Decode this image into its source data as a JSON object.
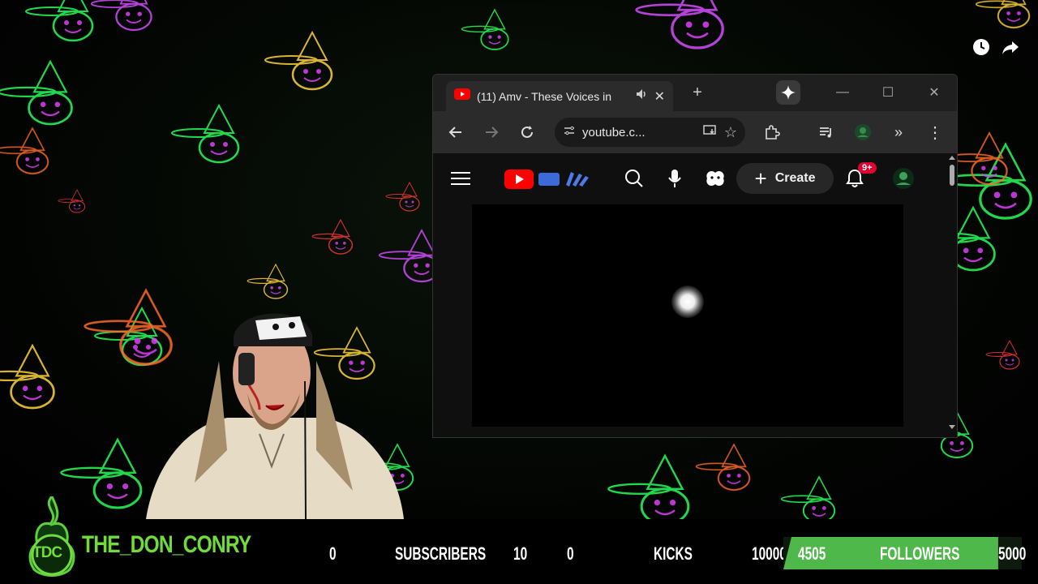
{
  "browser": {
    "tab_title": "(11) Amv - These Voices in",
    "address": "youtube.c...",
    "colors": {
      "frame": "#1f1f1f",
      "toolbar": "#2b2b2b",
      "page": "#0f0f0f"
    }
  },
  "youtube": {
    "create_label": "Create",
    "notification_count": "9+",
    "brand_red": "#ff0000"
  },
  "stream": {
    "channel_name": "THE_DON_CONRY",
    "logo_text": "TDC",
    "subscribers": {
      "label": "SUBSCRIBERS",
      "current": "0",
      "goal": "10"
    },
    "kicks": {
      "label": "KICKS",
      "current": "0",
      "goal": "10000"
    },
    "followers": {
      "label": "FOLLOWERS",
      "current": "4505",
      "goal": "5000",
      "progress": 0.901
    },
    "accent": "#6fdc3c"
  },
  "icons": [
    "clock-icon",
    "share-icon",
    "youtube-favicon",
    "speaker-icon",
    "close-icon",
    "new-tab-icon",
    "gemini-icon",
    "minimize-icon",
    "maximize-icon",
    "back-icon",
    "forward-icon",
    "reload-icon",
    "site-info-icon",
    "install-icon",
    "star-icon",
    "extensions-icon",
    "media-icon",
    "profile-icon",
    "more-icon",
    "menu-icon",
    "search-icon",
    "mic-icon",
    "ai-icon",
    "bell-icon",
    "avatar"
  ]
}
